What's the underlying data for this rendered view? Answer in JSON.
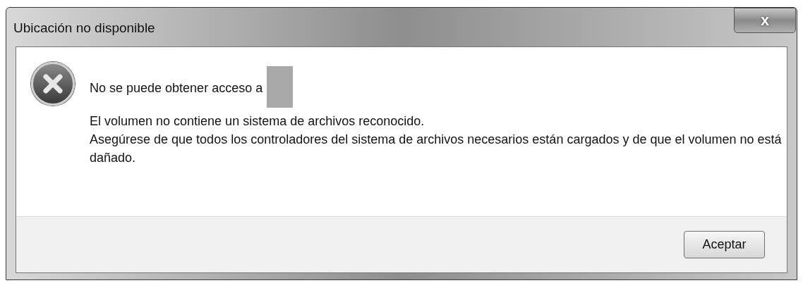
{
  "window": {
    "title": "Ubicación no disponible",
    "close_label": "x"
  },
  "message": {
    "heading": "No se puede obtener acceso a",
    "details": [
      "El volumen no contiene un sistema de archivos reconocido.",
      "Asegúrese de que todos los controladores del sistema de archivos necesarios están cargados y de que el volumen no está dañado."
    ]
  },
  "buttons": [
    "Aceptar"
  ]
}
